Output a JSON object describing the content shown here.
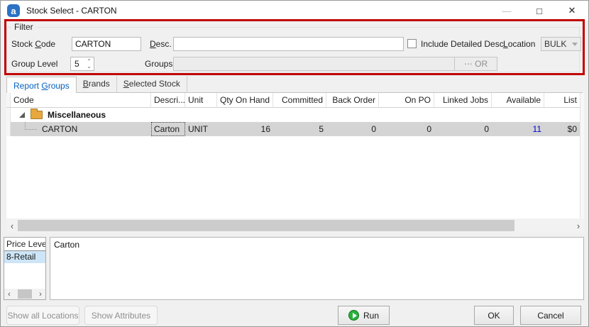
{
  "window": {
    "title": "Stock Select - CARTON",
    "app_icon_glyph": "a",
    "minimize_glyph": "—",
    "maximize_glyph": "□",
    "close_glyph": "✕"
  },
  "colors": {
    "annotation_red": "#c10000",
    "active_tab_blue": "#0563c1",
    "available_link_blue": "#0000d4",
    "selected_row_gray": "#d4d4d4",
    "price_level_selected_blue": "#cde5f7",
    "folder_icon_orange": "#e8a83e",
    "run_icon_green": "#29b33c"
  },
  "filter": {
    "legend": "Filter",
    "stock_code": {
      "label_pre": "Stock ",
      "label_key": "C",
      "label_post": "ode",
      "value": "CARTON"
    },
    "desc": {
      "label_pre": "",
      "label_key": "D",
      "label_post": "esc.",
      "value": ""
    },
    "include_detailed_desc": {
      "label": "Include Detailed Desc",
      "checked": false
    },
    "location": {
      "label_pre": "",
      "label_key": "L",
      "label_post": "ocation",
      "value": "BULK"
    },
    "group_level": {
      "label": "Group Level",
      "value": "5"
    },
    "groups": {
      "label": "Groups",
      "value": "",
      "button_label": "⋯ OR"
    }
  },
  "spinner": {
    "up_glyph": "⌃",
    "down_glyph": "⌄"
  },
  "tabs": [
    {
      "pre": "Report ",
      "key": "G",
      "post": "roups",
      "active": true
    },
    {
      "pre": "",
      "key": "B",
      "post": "rands",
      "active": false
    },
    {
      "pre": "",
      "key": "S",
      "post": "elected Stock",
      "active": false
    }
  ],
  "grid": {
    "columns": [
      "Code",
      "Descri...",
      "Unit",
      "Qty On Hand",
      "Committed",
      "Back Order",
      "On PO",
      "Linked Jobs",
      "Available",
      "List"
    ],
    "group_row": "Miscellaneous",
    "row": {
      "code": "CARTON",
      "desc": "Carton",
      "unit": "UNIT",
      "qty_on_hand": "16",
      "committed": "5",
      "back_order": "0",
      "on_po": "0",
      "linked_jobs": "0",
      "available": "11",
      "list": "$0"
    }
  },
  "scroll": {
    "left_glyph": "‹",
    "right_glyph": "›"
  },
  "price_level": {
    "header": "Price Level",
    "selected_row": "8-Retail"
  },
  "detail": {
    "text": "Carton"
  },
  "footer": {
    "show_all_locations": "Show all Locations",
    "show_attributes": "Show Attributes",
    "run": "Run",
    "ok": "OK",
    "cancel": "Cancel"
  }
}
